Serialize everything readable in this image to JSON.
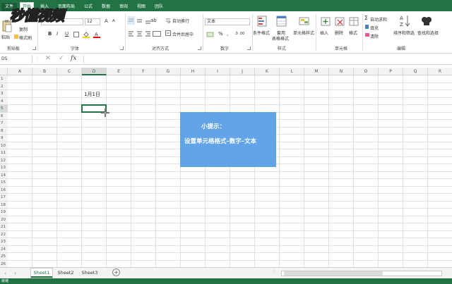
{
  "menu": {
    "tabs": [
      {
        "label": "文件",
        "active": false
      },
      {
        "label": "开始",
        "active": true
      },
      {
        "label": "插入",
        "active": false
      },
      {
        "label": "页面布局",
        "active": false
      },
      {
        "label": "公式",
        "active": false
      },
      {
        "label": "数据",
        "active": false
      },
      {
        "label": "审阅",
        "active": false
      },
      {
        "label": "视图",
        "active": false
      },
      {
        "label": "团队",
        "active": false
      }
    ]
  },
  "watermark": {
    "text": "秒懂视频"
  },
  "ribbon": {
    "clipboard": {
      "paste": "粘贴",
      "copy": "复制",
      "format_painter": "格式刷",
      "label": "剪贴板"
    },
    "font": {
      "size": "12",
      "bold": "B",
      "italic": "I",
      "underline": "U",
      "grow": "A",
      "shrink": "A",
      "label": "字体"
    },
    "alignment": {
      "wrap": "自动换行",
      "merge": "合并后居中",
      "label": "对齐方式"
    },
    "number": {
      "format": "文本",
      "percent": "%",
      "comma": ",",
      "label": "数字"
    },
    "styles": {
      "conditional": "条件格式",
      "table_line1": "套用",
      "table_line2": "表格格式",
      "cell_styles": "单元格样式",
      "label": "样式"
    },
    "cells": {
      "insert": "插入",
      "delete": "删除",
      "format": "格式",
      "label": "单元格"
    },
    "editing": {
      "autosum": "自动求和",
      "fill": "填充",
      "clear": "清除",
      "sort": "排序和筛选",
      "find": "查找和选择",
      "label": "编辑"
    }
  },
  "formula_bar": {
    "name_box": "D5",
    "cancel": "✕",
    "enter": "✓",
    "fx": "fx"
  },
  "grid": {
    "columns": [
      "A",
      "B",
      "C",
      "D",
      "E",
      "F",
      "G",
      "H",
      "I",
      "J",
      "K",
      "L",
      "M",
      "N",
      "O",
      "P",
      "Q",
      "R"
    ],
    "rows": [
      "1",
      "2",
      "3",
      "4",
      "5",
      "6",
      "7",
      "8",
      "9",
      "10",
      "11",
      "12",
      "13",
      "14",
      "15",
      "16",
      "17",
      "18",
      "19",
      "20",
      "21",
      "22",
      "23",
      "24",
      "25",
      "26"
    ],
    "selected_column": "D",
    "selected_row": "5",
    "cells": [
      {
        "ref": "D3",
        "value": "1月1日"
      }
    ]
  },
  "tip": {
    "title": "小提示：",
    "body": "设置单元格格式–数字–文本"
  },
  "sheets": {
    "tabs": [
      "Sheet1",
      "Sheet2",
      "Sheet3"
    ],
    "active": "Sheet1",
    "add": "+",
    "nav_prev": "‹",
    "nav_next": "›"
  },
  "status": {
    "text": "就绪"
  },
  "colors": {
    "accent": "#217346",
    "tip": "#5aa0e6"
  }
}
